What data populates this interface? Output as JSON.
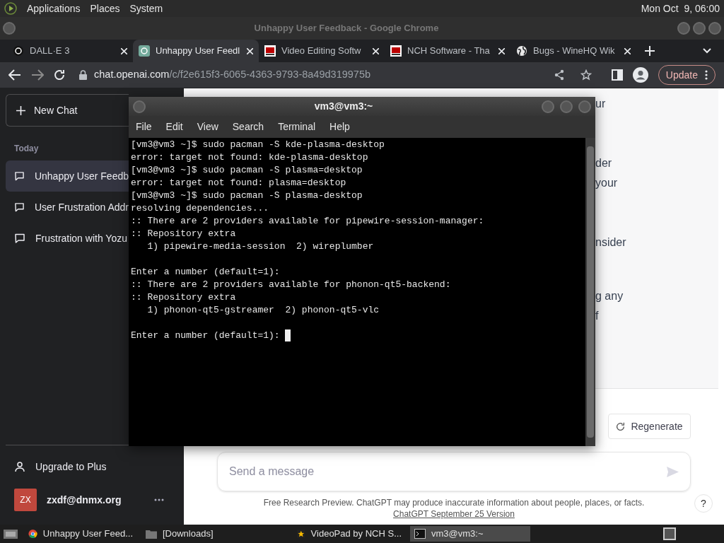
{
  "top_panel": {
    "menus": [
      "Applications",
      "Places",
      "System"
    ],
    "clock": "Mon Oct  9, 06:00"
  },
  "browser": {
    "title": "Unhappy User Feedback - Google Chrome",
    "tabs": [
      {
        "label": "DALL·E 3",
        "selected": false,
        "kind": "dark"
      },
      {
        "label": "Unhappy User Feedl",
        "selected": true,
        "kind": "green"
      },
      {
        "label": "Video Editing Softw",
        "selected": false,
        "kind": "red"
      },
      {
        "label": "NCH Software - Tha",
        "selected": false,
        "kind": "red"
      },
      {
        "label": "Bugs - WineHQ Wik",
        "selected": false,
        "kind": "globe"
      }
    ],
    "url_host": "chat.openai.com",
    "url_path": "/c/f2e615f3-6065-4363-9793-8a49d319975b",
    "update_button": "Update"
  },
  "sidebar": {
    "new_chat": "New Chat",
    "section": "Today",
    "chats": [
      {
        "label": "Unhappy User Feedb",
        "selected": true
      },
      {
        "label": "User Frustration Addr",
        "selected": false
      },
      {
        "label": "Frustration with Yozu",
        "selected": false
      }
    ],
    "upgrade": "Upgrade to Plus",
    "user": {
      "initials": "ZX",
      "email": "zxdf@dnmx.org"
    }
  },
  "chat": {
    "fragments": [
      "ur",
      "der",
      "your",
      "nsider",
      "g any",
      "f"
    ],
    "regenerate": "Regenerate",
    "input": {
      "placeholder": "Send a message"
    },
    "disclaimer": "Free Research Preview. ChatGPT may produce inaccurate information about people, places, or facts.",
    "version_link": "ChatGPT September 25 Version",
    "help": "?"
  },
  "terminal": {
    "title": "vm3@vm3:~",
    "menus": [
      "File",
      "Edit",
      "View",
      "Search",
      "Terminal",
      "Help"
    ],
    "lines": [
      {
        "kind": "output",
        "text": "[vm3@vm3 ~]$ sudo pacman -S kde-plasma-desktop"
      },
      {
        "kind": "output",
        "text": "error: target not found: kde-plasma-desktop"
      },
      {
        "kind": "output",
        "text": "[vm3@vm3 ~]$ sudo pacman -S plasma=desktop"
      },
      {
        "kind": "output",
        "text": "error: target not found: plasma=desktop"
      },
      {
        "kind": "output",
        "text": "[vm3@vm3 ~]$ sudo pacman -S plasma-desktop"
      },
      {
        "kind": "output",
        "text": "resolving dependencies..."
      },
      {
        "kind": "output",
        "text": ":: There are 2 providers available for pipewire-session-manager:"
      },
      {
        "kind": "output",
        "text": ":: Repository extra"
      },
      {
        "kind": "output",
        "text": "   1) pipewire-media-session  2) wireplumber"
      },
      {
        "kind": "blank"
      },
      {
        "kind": "output",
        "text": "Enter a number (default=1):"
      },
      {
        "kind": "output",
        "text": ":: There are 2 providers available for phonon-qt5-backend:"
      },
      {
        "kind": "output",
        "text": ":: Repository extra"
      },
      {
        "kind": "output",
        "text": "   1) phonon-qt5-gstreamer  2) phonon-qt5-vlc"
      },
      {
        "kind": "blank"
      },
      {
        "kind": "prompt",
        "text": "Enter a number (default=1): "
      }
    ]
  },
  "taskbar": {
    "items": [
      {
        "label": "Unhappy User Feed...",
        "selected": false,
        "kind": "browser"
      },
      {
        "label": "[Downloads]",
        "selected": false,
        "kind": "folder"
      },
      {
        "label": "VideoPad by NCH S...",
        "selected": false,
        "kind": "video"
      },
      {
        "label": "vm3@vm3:~",
        "selected": true,
        "kind": "terminal"
      }
    ]
  }
}
